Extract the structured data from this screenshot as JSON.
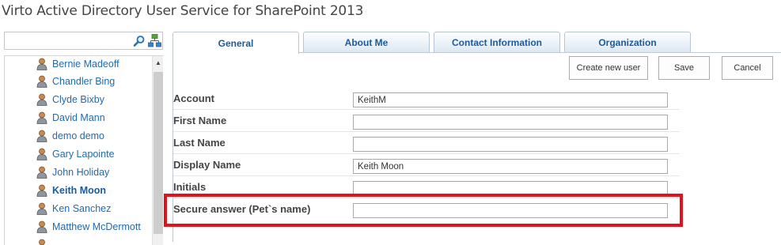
{
  "app": {
    "title": "Virto Active Directory User Service for SharePoint 2013"
  },
  "search": {
    "value": "",
    "placeholder": ""
  },
  "users": [
    {
      "name": "Bernie Madeoff",
      "selected": false
    },
    {
      "name": "Chandler Bing",
      "selected": false
    },
    {
      "name": "Clyde Bixby",
      "selected": false
    },
    {
      "name": "David Mann",
      "selected": false
    },
    {
      "name": "demo demo",
      "selected": false
    },
    {
      "name": "Gary Lapointe",
      "selected": false
    },
    {
      "name": "John Holiday",
      "selected": false
    },
    {
      "name": "Keith Moon",
      "selected": true
    },
    {
      "name": "Ken Sanchez",
      "selected": false
    },
    {
      "name": "Matthew McDermott",
      "selected": false
    }
  ],
  "scrollbar": {
    "up_glyph": "▲"
  },
  "tabs": [
    {
      "label": "General",
      "active": true
    },
    {
      "label": "About Me",
      "active": false
    },
    {
      "label": "Contact Information",
      "active": false
    },
    {
      "label": "Organization",
      "active": false
    }
  ],
  "toolbar": {
    "create_label": "Create new user",
    "save_label": "Save",
    "cancel_label": "Cancel"
  },
  "form": {
    "fields": [
      {
        "label": "Account",
        "value": "KeithM"
      },
      {
        "label": "First Name",
        "value": ""
      },
      {
        "label": "Last Name",
        "value": ""
      },
      {
        "label": "Display Name",
        "value": "Keith Moon"
      },
      {
        "label": "Initials",
        "value": ""
      },
      {
        "label": "Secure answer (Pet`s name)",
        "value": ""
      }
    ]
  },
  "colors": {
    "highlight": "#e0121b",
    "link": "#1f6ab0",
    "tab_text": "#1c5b9a"
  },
  "icons": {
    "search": "search-icon",
    "tree": "org-tree-icon",
    "user": "user-icon"
  }
}
